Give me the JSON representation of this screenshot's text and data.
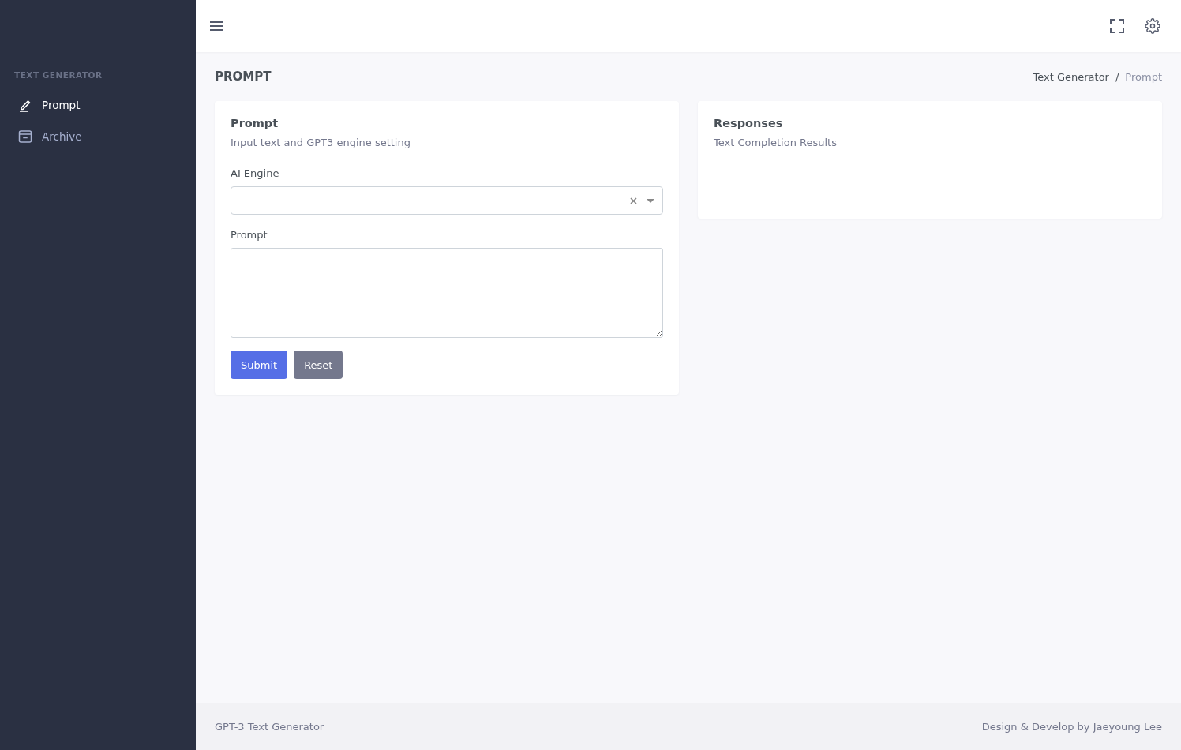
{
  "sidebar": {
    "section_title": "TEXT GENERATOR",
    "items": [
      {
        "label": "Prompt",
        "kind": "pencil",
        "selected": true
      },
      {
        "label": "Archive",
        "kind": "archive",
        "selected": false
      }
    ]
  },
  "page": {
    "title": "PROMPT",
    "breadcrumb": [
      {
        "label": "Text Generator",
        "current": false
      },
      {
        "label": "/",
        "current": false
      },
      {
        "label": "Prompt",
        "current": true
      }
    ]
  },
  "prompt_card": {
    "title": "Prompt",
    "subtitle": "Input text and GPT3 engine setting",
    "engine_label": "AI Engine",
    "prompt_label": "Prompt",
    "buttons": [
      {
        "label": "Submit",
        "kind": "primary"
      },
      {
        "label": "Reset",
        "kind": "secondary"
      }
    ]
  },
  "responses_card": {
    "title": "Responses",
    "subtitle": "Text Completion Results"
  },
  "footer": {
    "left": "GPT-3 Text Generator",
    "right": "Design & Develop by Jaeyoung Lee"
  }
}
